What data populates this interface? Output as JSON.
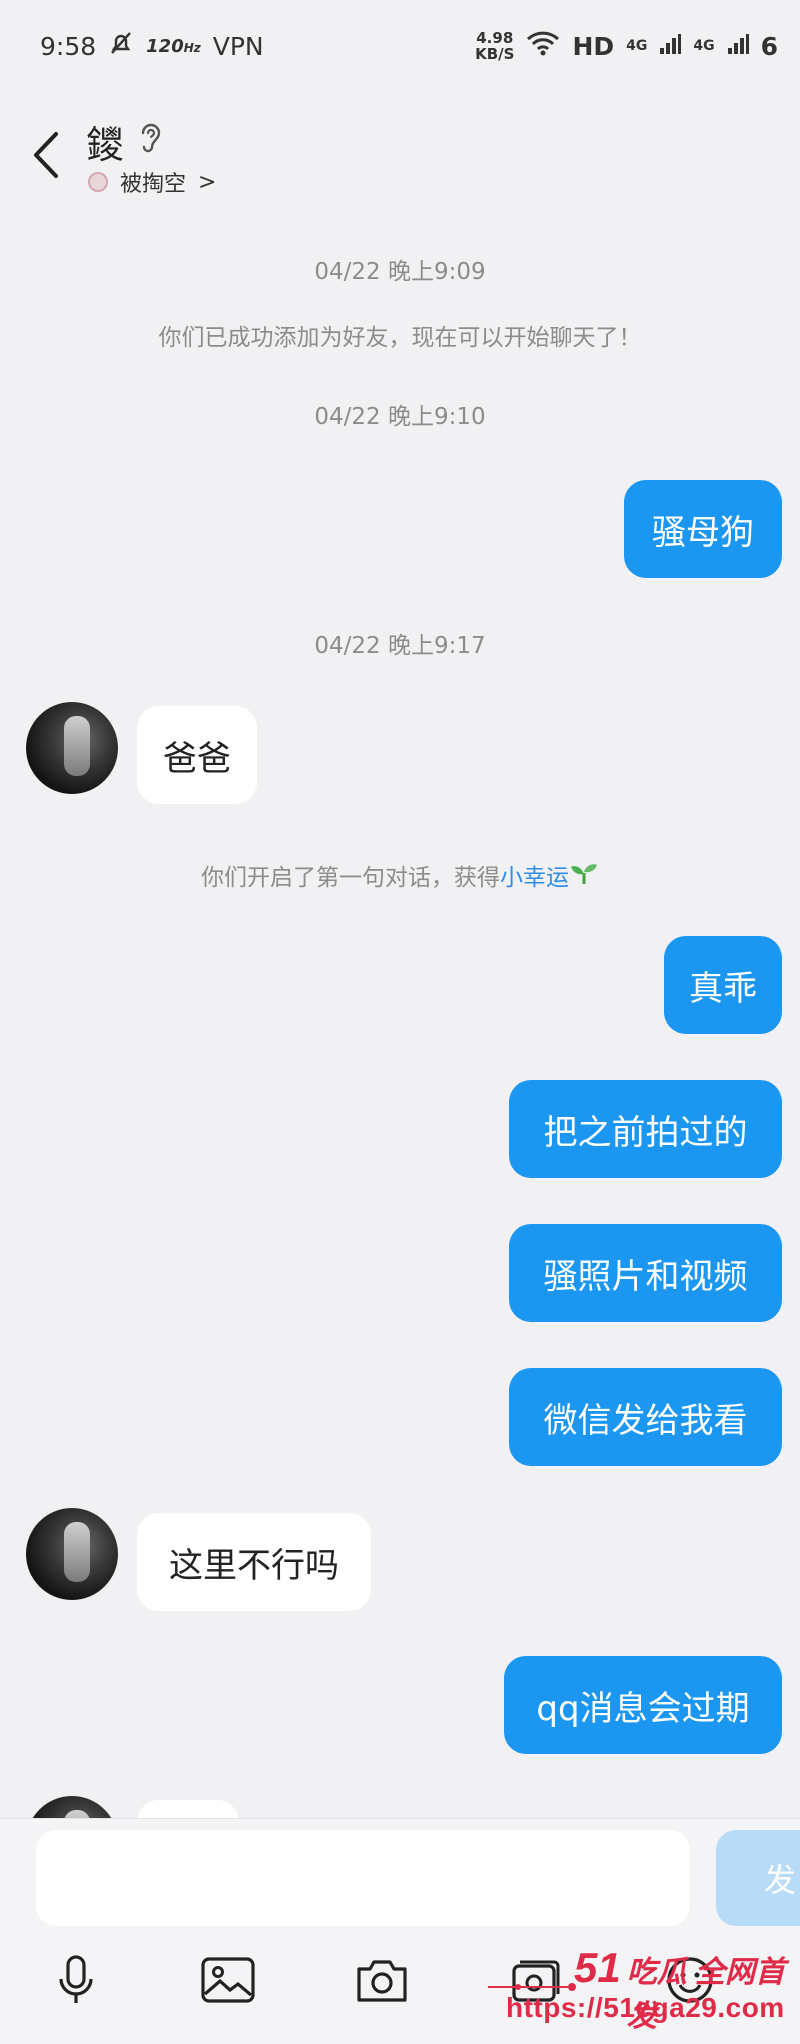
{
  "status": {
    "time": "9:58",
    "refresh": "120",
    "refresh_unit": "Hz",
    "vpn": "VPN",
    "speed_value": "4.98",
    "speed_unit": "KB/S",
    "hd": "HD",
    "net1": "4G",
    "net2": "4G",
    "battery": "6"
  },
  "header": {
    "title": "鑁",
    "subtitle": "被掏空",
    "subtitle_chevron": ">"
  },
  "messages": {
    "ts1": "04/22 晚上9:09",
    "system1": "你们已成功添加为好友，现在可以开始聊天了！",
    "ts2": "04/22 晚上9:10",
    "out1": "骚母狗",
    "ts3": "04/22 晚上9:17",
    "in1": "爸爸",
    "system2_prefix": "你们开启了第一句对话，获得",
    "system2_link": "小幸运",
    "out2": "真乖",
    "out3": "把之前拍过的",
    "out4": "骚照片和视频",
    "out5": "微信发给我看",
    "in2": "这里不行吗",
    "out6": "qq消息会过期"
  },
  "composer": {
    "input_value": "",
    "send_label": "发"
  },
  "watermark": {
    "brand_num": "51",
    "brand_text": "吃瓜 全网首发",
    "url": "https://51cga29.com"
  },
  "icons": {
    "back": "chevron-left-icon",
    "ear": "ear-icon",
    "mic": "microphone-icon",
    "image": "image-icon",
    "camera": "camera-icon",
    "album": "album-icon",
    "emoji": "emoji-icon"
  },
  "colors": {
    "outgoing_bubble": "#1b97f2",
    "incoming_bubble": "#ffffff",
    "link": "#2c8ee6",
    "send_disabled": "#b8dbf7",
    "watermark": "#e02b48"
  }
}
